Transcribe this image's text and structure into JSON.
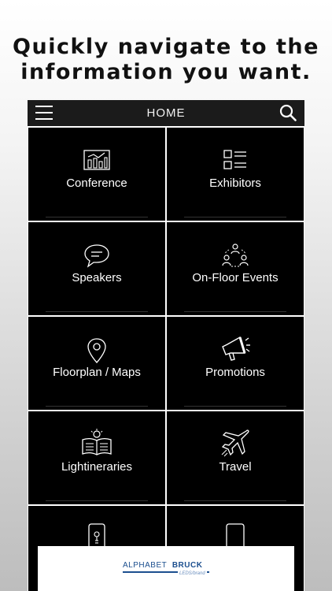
{
  "headline": {
    "line1": "Quickly navigate to the",
    "line2": "information you want."
  },
  "topbar": {
    "title": "HOME"
  },
  "tiles": [
    {
      "label": "Conference",
      "icon": "presentation-chart-icon"
    },
    {
      "label": "Exhibitors",
      "icon": "list-grid-icon"
    },
    {
      "label": "Speakers",
      "icon": "chat-bubble-icon"
    },
    {
      "label": "On-Floor Events",
      "icon": "people-network-icon"
    },
    {
      "label": "Floorplan / Maps",
      "icon": "map-pin-icon"
    },
    {
      "label": "Promotions",
      "icon": "megaphone-icon"
    },
    {
      "label": "Lightineraries",
      "icon": "book-lightbulb-icon"
    },
    {
      "label": "Travel",
      "icon": "airplane-icon"
    },
    {
      "label": "",
      "icon": "phone-bulb-icon"
    },
    {
      "label": "",
      "icon": "phone-icon"
    }
  ],
  "footer": {
    "logo_part1": "ALPHABET",
    "logo_part2": "BRUCK",
    "logo_tagline": "LEDS/brand"
  },
  "colors": {
    "tile_background": "#000000",
    "topbar_background": "#1b1b1b",
    "logo_blue": "#1c4f8f"
  }
}
